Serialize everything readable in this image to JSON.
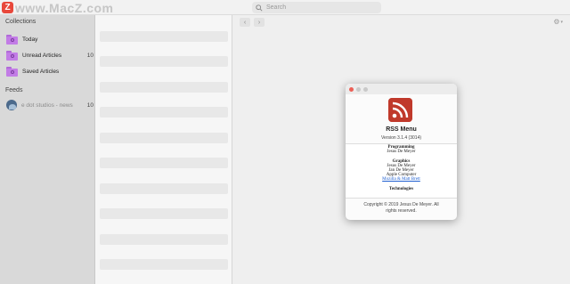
{
  "watermark": {
    "logo_letter": "Z",
    "text": "www.MacZ.com"
  },
  "search": {
    "placeholder": "Search"
  },
  "sidebar": {
    "collections_title": "Collections",
    "collections": [
      {
        "label": "Today",
        "count": ""
      },
      {
        "label": "Unread Articles",
        "count": "10"
      },
      {
        "label": "Saved Articles",
        "count": ""
      }
    ],
    "feeds_title": "Feeds",
    "feeds": [
      {
        "label": "e dot studios - news",
        "count": "10"
      }
    ]
  },
  "toolbar": {
    "back_glyph": "‹",
    "forward_glyph": "›",
    "settings_glyph": "⚙",
    "menu_glyph": "▾"
  },
  "about": {
    "app_name": "RSS Menu",
    "version": "Version 3.1.4 (3014)",
    "credits": {
      "programming_title": "Programming",
      "programming_names": [
        "Jesus De Meyer"
      ],
      "graphics_title": "Graphics",
      "graphics_names": [
        "Jesus De Meyer",
        "Jan De Meyer",
        "Apple Computer"
      ],
      "graphics_link": "Mozilla & Matt Brett",
      "technologies_title": "Technologies"
    },
    "copyright_line1": "Copyright © 2019 Jesus De Meyer. All",
    "copyright_line2": "rights reserved."
  },
  "colors": {
    "close": "#ec5f56",
    "minimize": "#c9c9c9",
    "zoom": "#c9c9c9",
    "accent": "#c0392b",
    "folder": "#c27ce6"
  },
  "icons": [
    "search-icon",
    "folder-icon",
    "feed-avatar",
    "settings-icon",
    "rss-app-icon"
  ]
}
